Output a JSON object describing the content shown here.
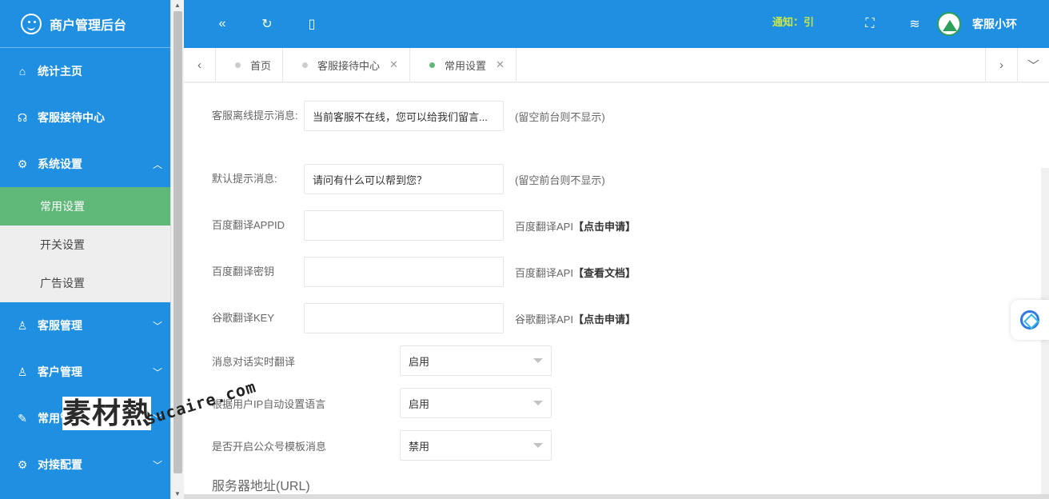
{
  "app": {
    "title": "商户管理后台"
  },
  "sidebar": {
    "items": [
      {
        "label": "统计主页",
        "icon": "home-icon"
      },
      {
        "label": "客服接待中心",
        "icon": "headset-icon"
      },
      {
        "label": "系统设置",
        "icon": "gear-icon",
        "expanded": true,
        "children": [
          {
            "label": "常用设置",
            "active": true
          },
          {
            "label": "开关设置"
          },
          {
            "label": "广告设置"
          }
        ]
      },
      {
        "label": "客服管理",
        "icon": "user-icon"
      },
      {
        "label": "客户管理",
        "icon": "users-icon"
      },
      {
        "label": "常用管理",
        "icon": "edit-icon"
      },
      {
        "label": "对接配置",
        "icon": "plug-icon"
      }
    ]
  },
  "topbar": {
    "notice": "通知：引",
    "username": "客服小环"
  },
  "tabs": [
    {
      "label": "首页",
      "closable": false
    },
    {
      "label": "客服接待中心",
      "closable": true
    },
    {
      "label": "常用设置",
      "closable": true,
      "active": true
    }
  ],
  "form": {
    "offline_msg": {
      "label": "客服离线提示消息:",
      "value": "当前客服不在线，您可以给我们留言...",
      "hint": "(留空前台则不显示)"
    },
    "default_msg": {
      "label": "默认提示消息:",
      "value": "请问有什么可以帮到您？",
      "hint": "(留空前台则不显示)"
    },
    "baidu_appid": {
      "label": "百度翻译APPID",
      "value": "",
      "hint_prefix": "百度翻译API",
      "hint_link": "【点击申请】"
    },
    "baidu_secret": {
      "label": "百度翻译密钥",
      "value": "",
      "hint_prefix": "百度翻译API",
      "hint_link": "【查看文档】"
    },
    "google_key": {
      "label": "谷歌翻译KEY",
      "value": "",
      "hint_prefix": "谷歌翻译API",
      "hint_link": "【点击申请】"
    },
    "realtime_translate": {
      "label": "消息对话实时翻译",
      "value": "启用"
    },
    "auto_lang": {
      "label": "根据用户IP自动设置语言",
      "value": "启用"
    },
    "wechat_template": {
      "label": "是否开启公众号模板消息",
      "value": "禁用"
    },
    "server_section": "服务器地址(URL)"
  },
  "watermark": {
    "cn": "素材熱",
    "en": "sucaire.com"
  }
}
